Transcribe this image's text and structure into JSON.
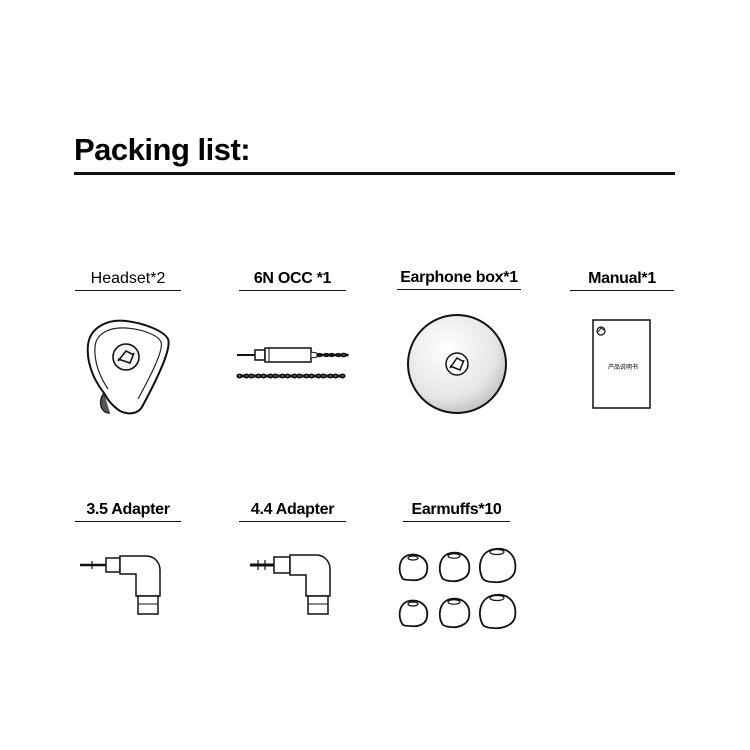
{
  "page": {
    "title": "Packing list:"
  },
  "items": [
    {
      "label": "Headset*2",
      "icon": "earphone-icon"
    },
    {
      "label": "6N OCC *1",
      "icon": "cable-icon"
    },
    {
      "label": "Earphone box*1",
      "icon": "earphone-box-icon"
    },
    {
      "label": "Manual*1",
      "icon": "manual-icon"
    },
    {
      "label": "3.5 Adapter",
      "icon": "adapter-3-5-icon"
    },
    {
      "label": "4.4 Adapter",
      "icon": "adapter-4-4-icon"
    },
    {
      "label": "Earmuffs*10",
      "icon": "ear-tips-icon"
    }
  ],
  "manual_cover_text": "产品说明书"
}
